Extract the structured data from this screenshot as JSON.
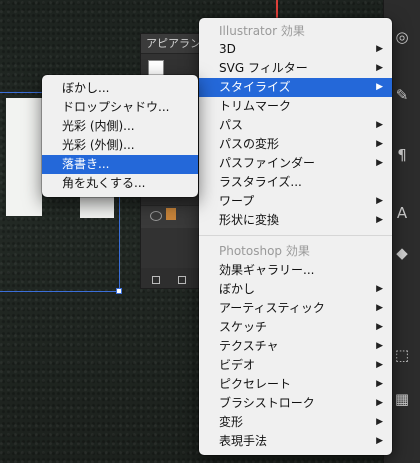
{
  "appearance_panel": {
    "tab_label": "アピアラン"
  },
  "effect_menu": {
    "illustrator_header": "Illustrator 効果",
    "illustrator_items": [
      {
        "label": "3D",
        "submenu": true
      },
      {
        "label": "SVG フィルター",
        "submenu": true
      },
      {
        "label": "スタイライズ",
        "submenu": true,
        "highlighted": true
      },
      {
        "label": "トリムマーク",
        "submenu": false
      },
      {
        "label": "パス",
        "submenu": true
      },
      {
        "label": "パスの変形",
        "submenu": true
      },
      {
        "label": "パスファインダー",
        "submenu": true
      },
      {
        "label": "ラスタライズ...",
        "submenu": false
      },
      {
        "label": "ワープ",
        "submenu": true
      },
      {
        "label": "形状に変換",
        "submenu": true
      }
    ],
    "photoshop_header": "Photoshop 効果",
    "photoshop_items": [
      {
        "label": "効果ギャラリー...",
        "submenu": false
      },
      {
        "label": "ぼかし",
        "submenu": true
      },
      {
        "label": "アーティスティック",
        "submenu": true
      },
      {
        "label": "スケッチ",
        "submenu": true
      },
      {
        "label": "テクスチャ",
        "submenu": true
      },
      {
        "label": "ビデオ",
        "submenu": true
      },
      {
        "label": "ピクセレート",
        "submenu": true
      },
      {
        "label": "ブラシストローク",
        "submenu": true
      },
      {
        "label": "変形",
        "submenu": true
      },
      {
        "label": "表現手法",
        "submenu": true
      }
    ]
  },
  "stylize_submenu": {
    "items": [
      {
        "label": "ぼかし...",
        "highlighted": false
      },
      {
        "label": "ドロップシャドウ...",
        "highlighted": false
      },
      {
        "label": "光彩 (内側)...",
        "highlighted": false
      },
      {
        "label": "光彩 (外側)...",
        "highlighted": false
      },
      {
        "label": "落書き...",
        "highlighted": true
      },
      {
        "label": "角を丸くする...",
        "highlighted": false
      }
    ]
  },
  "colors": {
    "highlight": "#2468d9",
    "selection": "#3b6fd8",
    "menu_bg": "#f0f0f0"
  }
}
